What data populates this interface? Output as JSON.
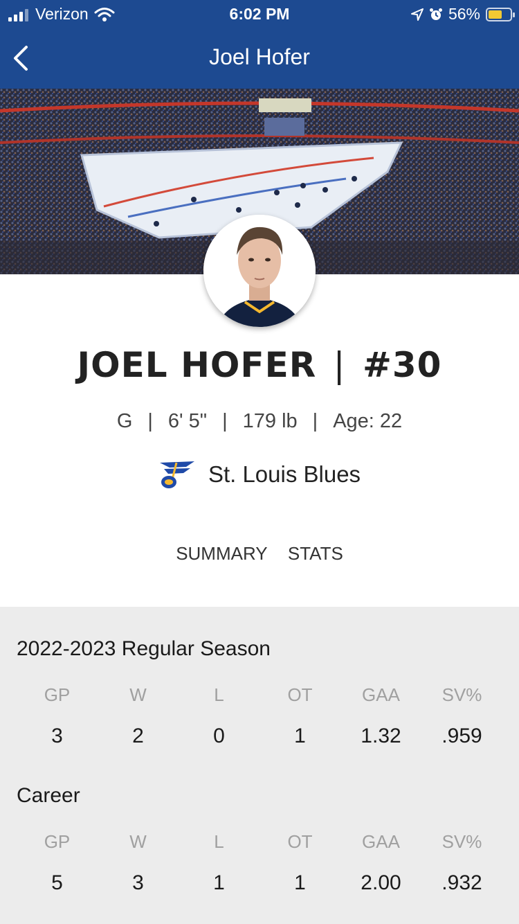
{
  "status_bar": {
    "carrier": "Verizon",
    "time": "6:02 PM",
    "battery": "56%",
    "icons": [
      "signal-icon",
      "wifi-icon",
      "location-icon",
      "alarm-icon",
      "battery-icon"
    ]
  },
  "nav": {
    "title": "Joel Hofer",
    "back_icon": "chevron-left-icon"
  },
  "player": {
    "name": "JOEL HOFER",
    "divider": "|",
    "number": "#30",
    "position": "G",
    "height": "6' 5\"",
    "weight": "179 lb",
    "age": "Age: 22",
    "team": "St. Louis Blues"
  },
  "tabs": [
    "SUMMARY",
    "STATS"
  ],
  "stat_headers": [
    "GP",
    "W",
    "L",
    "OT",
    "GAA",
    "SV%"
  ],
  "regular_season": {
    "title": "2022-2023 Regular Season",
    "values": [
      "3",
      "2",
      "0",
      "1",
      "1.32",
      ".959"
    ]
  },
  "career": {
    "title": "Career",
    "values": [
      "5",
      "3",
      "1",
      "1",
      "2.00",
      ".932"
    ]
  },
  "colors": {
    "nav_bg": "#1d4a91",
    "stats_bg": "#ececec",
    "blues_blue": "#1f4aa8",
    "blues_gold": "#f5b82e"
  }
}
